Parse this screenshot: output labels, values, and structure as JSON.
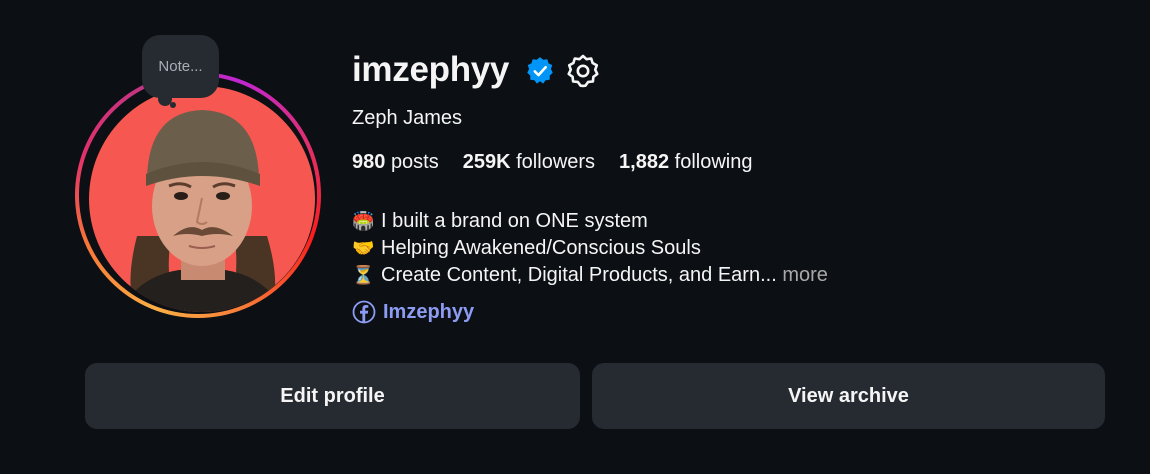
{
  "profile": {
    "username": "imzephyy",
    "full_name": "Zeph James",
    "note_placeholder": "Note...",
    "verified": true
  },
  "stats": {
    "posts_count": "980",
    "posts_label": "posts",
    "followers_count": "259K",
    "followers_label": "followers",
    "following_count": "1,882",
    "following_label": "following"
  },
  "bio": {
    "lines": [
      {
        "emoji": "🏟️",
        "text": "I built a brand on ONE system"
      },
      {
        "emoji": "🤝",
        "text": "Helping Awakened/Conscious Souls"
      },
      {
        "emoji": "⏳",
        "text": "Create Content, Digital Products, and Earn..."
      }
    ],
    "more_label": "more"
  },
  "link": {
    "icon": "facebook-icon",
    "text": "Imzephyy"
  },
  "buttons": {
    "edit_profile": "Edit profile",
    "view_archive": "View archive"
  },
  "colors": {
    "background": "#0c0f14",
    "button_bg": "#262a31",
    "link": "#8c9cf3",
    "verified": "#0095f6",
    "avatar_bg": "#f65750"
  }
}
